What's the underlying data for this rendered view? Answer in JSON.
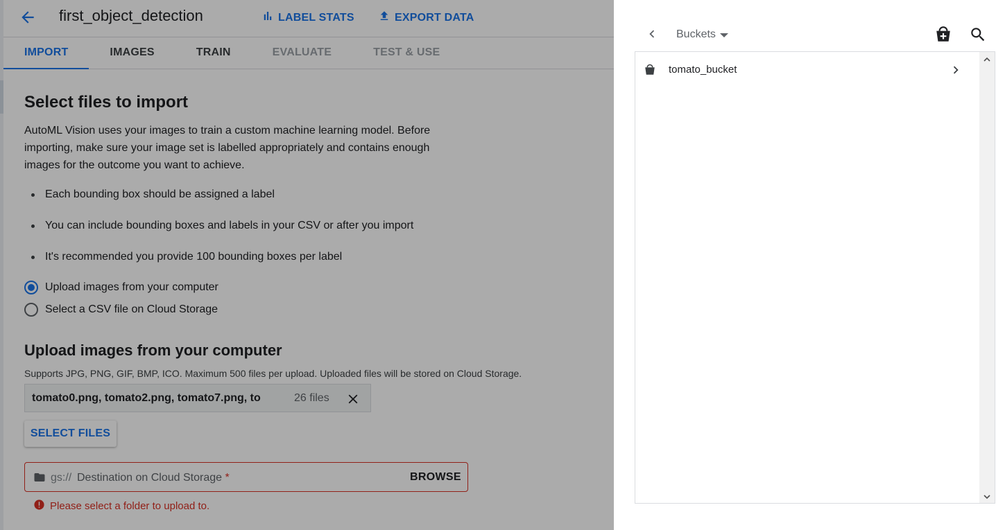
{
  "header": {
    "title": "first_object_detection",
    "label_stats": "LABEL STATS",
    "export_data": "EXPORT DATA"
  },
  "tabs": [
    {
      "label": "IMPORT",
      "state": "active"
    },
    {
      "label": "IMAGES",
      "state": "enabled"
    },
    {
      "label": "TRAIN",
      "state": "enabled"
    },
    {
      "label": "EVALUATE",
      "state": "disabled"
    },
    {
      "label": "TEST & USE",
      "state": "disabled"
    }
  ],
  "import": {
    "heading": "Select files to import",
    "description": "AutoML Vision uses your images to train a custom machine learning model. Before importing, make sure your image set is labelled appropriately and contains enough images for the outcome you want to achieve.",
    "bullets": [
      "Each bounding box should be assigned a label",
      "You can include bounding boxes and labels in your CSV or after you import",
      "It's recommended you provide 100 bounding boxes per label"
    ],
    "options": [
      {
        "label": "Upload images from your computer",
        "selected": true
      },
      {
        "label": "Select a CSV file on Cloud Storage",
        "selected": false
      }
    ]
  },
  "upload": {
    "heading": "Upload images from your computer",
    "supports": "Supports JPG, PNG, GIF, BMP, ICO. Maximum 500 files per upload. Uploaded files will be stored on Cloud Storage.",
    "file_names": "tomato0.png, tomato2.png, tomato7.png, to...",
    "file_count": "26 files",
    "select_files": "SELECT FILES",
    "destination_prefix": "gs://",
    "destination_label": "Destination on Cloud Storage",
    "required_mark": "*",
    "browse": "BROWSE",
    "error": "Please select a folder to upload to."
  },
  "panel": {
    "breadcrumb": "Buckets",
    "buckets": [
      {
        "name": "tomato_bucket"
      }
    ]
  },
  "colors": {
    "accent": "#1a73e8",
    "error": "#d93025",
    "overlay": "rgba(0,0,0,0.33)"
  }
}
